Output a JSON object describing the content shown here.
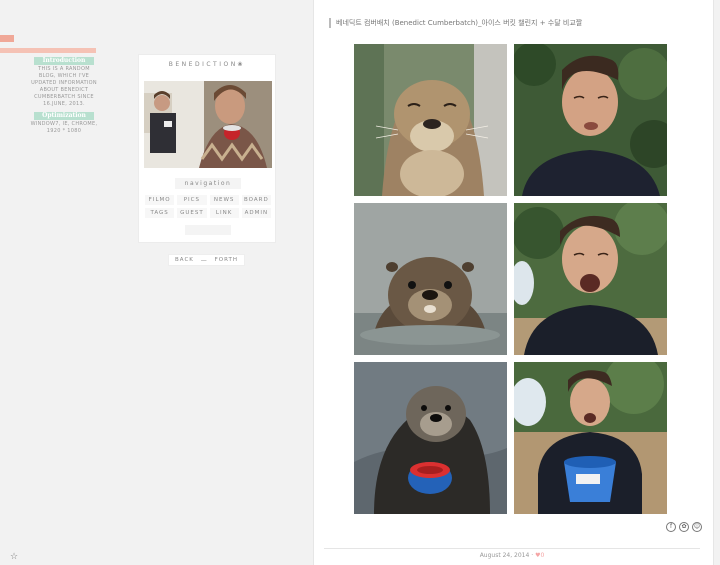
{
  "sidebar": {
    "introduction_label": "Introduction",
    "introduction_text": "THIS IS A RANDOM BLOG, WHICH I'VE UPDATED INFORMATION ABOUT BENEDICT CUMBERBATCH SINCE 16.JUNE, 2013.",
    "optimization_label": "Optimization",
    "optimization_text": "WINDOW7, IE, CHROME, 1920 * 1080",
    "bottom_icon": "☆"
  },
  "profile": {
    "title": "BENEDICTION❀",
    "navigation_label": "navigation",
    "nav_items": [
      "FILMO",
      "PICS",
      "NEWS",
      "BOARD",
      "TAGS",
      "GUEST",
      "LINK",
      "ADMIN"
    ]
  },
  "pager": {
    "back": "BACK",
    "separator": "—",
    "forth": "FORTH"
  },
  "post": {
    "title": "베네딕트 컴버배치 (Benedict Cumberbatch)_아이스 버킷 챌린지 + 수달 비교짤",
    "date": "August 24, 2014",
    "separator": "·",
    "heart": "♥",
    "likes": "0",
    "share_icons": [
      "f",
      "✿",
      "☺"
    ]
  },
  "colors": {
    "mint": "#b8e0cf",
    "coral": "#f0a898",
    "heart": "#f5a5a5"
  }
}
